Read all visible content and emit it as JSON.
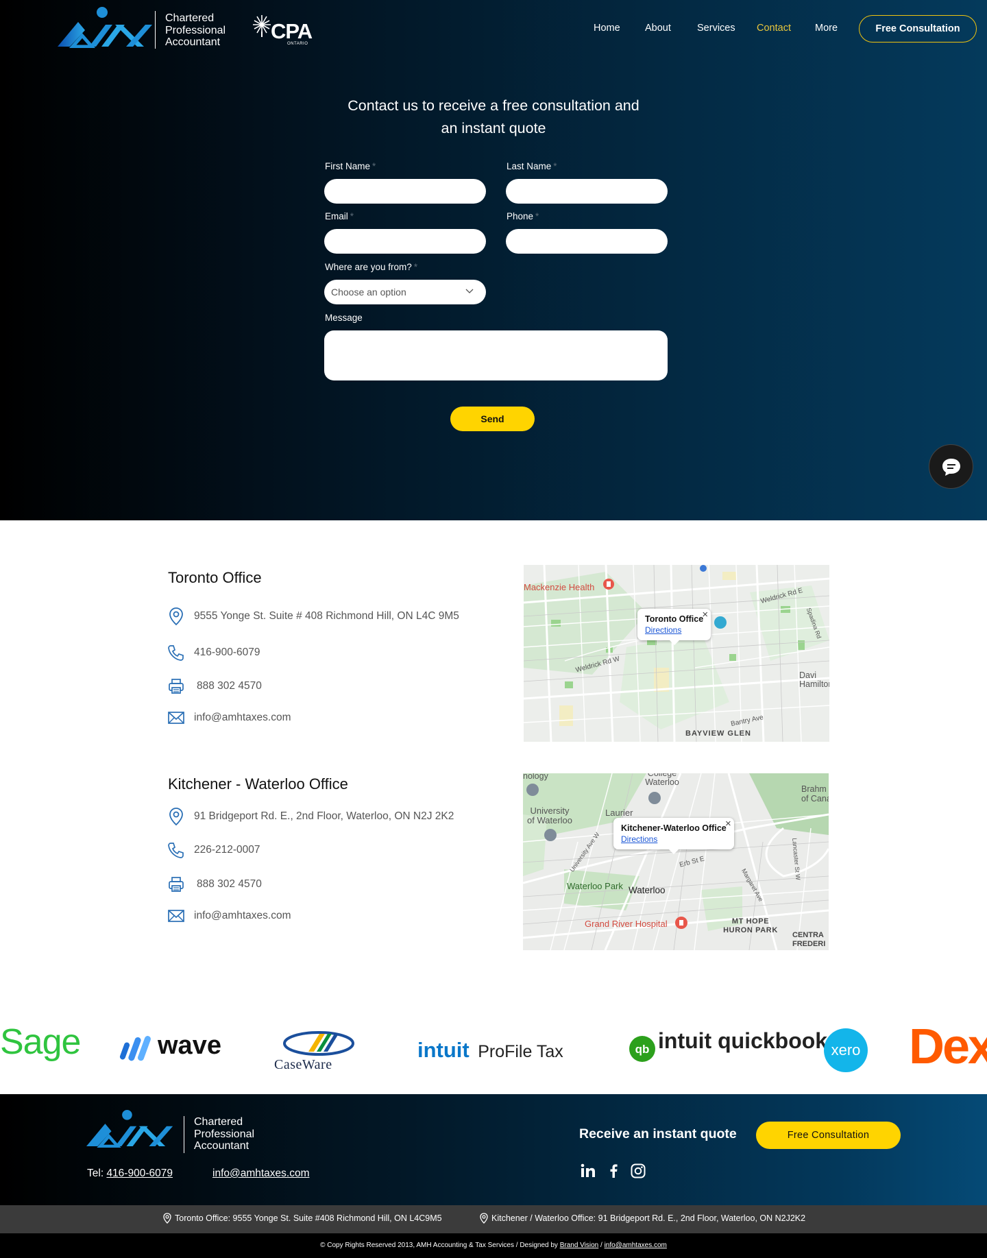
{
  "header": {
    "logo_text": [
      "Chartered",
      "Professional",
      "Accountant"
    ],
    "cpa_logo": "CPA",
    "cpa_sub": "ONTARIO",
    "nav": [
      {
        "label": "Home",
        "active": false
      },
      {
        "label": "About",
        "active": false
      },
      {
        "label": "Services",
        "active": false
      },
      {
        "label": "Contact",
        "active": true
      },
      {
        "label": "More",
        "active": false
      }
    ],
    "cta_label": "Free Consultation"
  },
  "form": {
    "title_line1": "Contact us to receive a free consultation and",
    "title_line2": "an instant quote",
    "first_name_label": "First Name",
    "last_name_label": "Last Name",
    "email_label": "Email",
    "phone_label": "Phone",
    "origin_label": "Where are you from?",
    "origin_placeholder": "Choose an option",
    "message_label": "Message",
    "required_mark": "*",
    "send_label": "Send"
  },
  "offices": [
    {
      "name": "Toronto Office",
      "address": "9555 Yonge St. Suite # 408 Richmond Hill, ON L4C 9M5",
      "phone": "416-900-6079",
      "fax": "888 302 4570",
      "email": "info@amhtaxes.com",
      "map_popup_title": "Toronto Office",
      "map_popup_link": "Directions",
      "map_labels": [
        "Mackenzie Health",
        "Weldrick Rd W",
        "Weldrick Rd E",
        "BAYVIEW GLEN",
        "Bantry Ave",
        "Davi Hamilton",
        "Bayview",
        "Spadina Rd"
      ]
    },
    {
      "name": "Kitchener - Waterloo Office",
      "address": "91 Bridgeport Rd. E., 2nd Floor, Waterloo, ON N2J 2K2",
      "phone": "226-212-0007",
      "fax": "888 302 4570",
      "email": "info@amhtaxes.com",
      "map_popup_title": "Kitchener-Waterloo Office",
      "map_popup_link": "Directions",
      "map_labels": [
        "University of Waterloo",
        "Laurier",
        "Waterloo Park",
        "Waterloo",
        "Grand River Hospital",
        "MT HOPE HURON PARK",
        "CENTRA FREDERI",
        "Brahm of Cana",
        "Erb St E",
        "Margaret Ave",
        "College Waterloo",
        "nology",
        "Lancaster St W",
        "University Ave W"
      ]
    }
  ],
  "partners": [
    "Sage",
    "wave",
    "CaseWare",
    "intuit",
    "ProFile Tax",
    "intuit quickbooks",
    "xero",
    "Dext"
  ],
  "footer": {
    "logo_text": [
      "Chartered",
      "Professional",
      "Accountant"
    ],
    "tel_prefix": "Tel: ",
    "tel": "416-900-6079",
    "email": "info@amhtaxes.com",
    "quote_text": "Receive an instant quote",
    "cta_label": "Free Consultation",
    "social_icons": [
      "linkedin-icon",
      "facebook-icon",
      "instagram-icon"
    ],
    "toronto_address": "Toronto Office: 9555 Yonge St. Suite #408 Richmond Hill, ON L4C9M5",
    "kitchener_address": "Kitchener / Waterloo Office: 91 Bridgeport Rd. E., 2nd Floor, Waterloo, ON N2J2K2",
    "copyright": "© Copy Rights Reserved 2013, AMH Accounting & Tax Services / Designed by",
    "designer": "Brand Vision",
    "separator": " / ",
    "copy_email": "info@amhtaxes.com"
  },
  "colors": {
    "accent_yellow": "#ffd400",
    "nav_active": "#e8c63c",
    "brand_blue": "#1e8fd8",
    "icon_blue": "#2a6fb5"
  }
}
